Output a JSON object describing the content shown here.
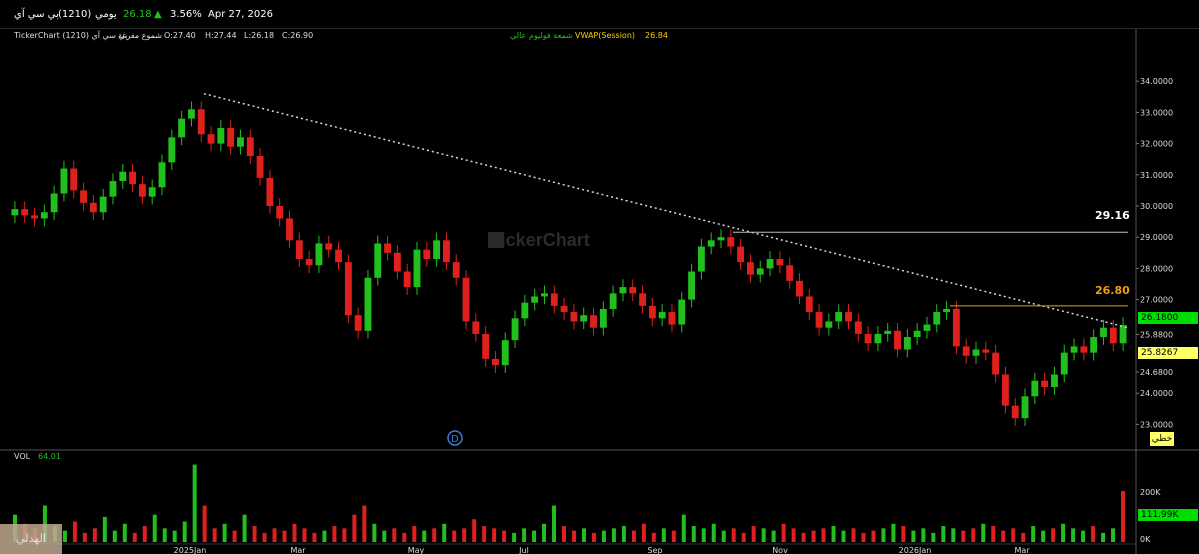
{
  "header": {
    "symbol": "بي سي آي",
    "code": "(1210)",
    "period": "يومي",
    "last_price": "26.18",
    "change_pct": "3.56%",
    "date": "Apr 27, 2026"
  },
  "info_bar": {
    "source": "TickerChart (1210) بي سي آي",
    "chart_type": "شموع مفرغة",
    "open": "O:27.40",
    "high": "H:27.44",
    "low": "L:26.18",
    "close": "C:26.90",
    "indicator_label": "شمعة فوليوم عالي",
    "vwap_label": "VWAP(Session)",
    "vwap_value": "26.84"
  },
  "watermark": "TickerChart",
  "colors": {
    "up": "#22c01e",
    "down": "#e0201c",
    "orange": "#f39c12",
    "price_tag": "#00dd00",
    "yellow_tag": "#ffff66",
    "line_label": "#ffffff",
    "dotted_trend": "#d8d8d8"
  },
  "price_axis": [
    "34.0000",
    "33.0000",
    "32.0000",
    "31.0000",
    "30.0000",
    "29.0000",
    "28.0000",
    "27.0000",
    "25.8800",
    "24.6800",
    "24.0000",
    "23.0000"
  ],
  "price_tags": {
    "current": "26.1800",
    "secondary": "25.8267",
    "mode": "خطي"
  },
  "level_labels": {
    "resistance_white": "29.16",
    "resistance_orange": "26.80"
  },
  "date_axis": [
    "2025Jan",
    "Mar",
    "May",
    "Jul",
    "Sep",
    "Nov",
    "2026Jan",
    "Mar"
  ],
  "volume_panel": {
    "label": "VOL",
    "value": "64.01",
    "axis_top": "200K",
    "axis_zero": "0K",
    "current_tag": "111.99K"
  },
  "dividend_marker": "D",
  "watermark_name": "الهذلي",
  "chart_data": {
    "type": "candlestick",
    "series": [
      {
        "name": "price",
        "values": [
          29.9,
          29.7,
          29.6,
          29.8,
          30.4,
          31.2,
          30.5,
          30.1,
          29.8,
          30.3,
          30.8,
          31.1,
          30.7,
          30.3,
          30.6,
          31.4,
          32.2,
          32.8,
          33.1,
          32.3,
          32.0,
          32.5,
          31.9,
          32.2,
          31.6,
          30.9,
          30.0,
          29.6,
          28.9,
          28.3,
          28.1,
          28.8,
          28.6,
          28.2,
          26.5,
          26.0,
          27.7,
          28.8,
          28.5,
          27.9,
          27.4,
          28.6,
          28.3,
          28.9,
          28.2,
          27.7,
          26.3,
          25.9,
          25.1,
          24.9,
          25.7,
          26.4,
          26.9,
          27.1,
          27.2,
          26.8,
          26.6,
          26.3,
          26.5,
          26.1,
          26.7,
          27.2,
          27.4,
          27.2,
          26.8,
          26.4,
          26.6,
          26.2,
          27.0,
          27.9,
          28.7,
          28.9,
          29.0,
          28.7,
          28.2,
          27.8,
          28.0,
          28.3,
          28.1,
          27.6,
          27.1,
          26.6,
          26.1,
          26.3,
          26.6,
          26.3,
          25.9,
          25.6,
          25.9,
          26.0,
          25.4,
          25.8,
          26.0,
          26.2,
          26.6,
          26.7,
          25.5,
          25.2,
          25.4,
          25.3,
          24.6,
          23.6,
          23.2,
          23.9,
          24.4,
          24.2,
          24.6,
          25.3,
          25.5,
          25.3,
          25.8,
          26.1,
          25.6,
          26.18
        ]
      },
      {
        "name": "VWAP(Session)",
        "values": [
          26.84
        ]
      }
    ],
    "volume": [
      60,
      40,
      30,
      80,
      35,
      25,
      45,
      20,
      30,
      55,
      25,
      40,
      20,
      35,
      60,
      30,
      25,
      45,
      170,
      80,
      30,
      40,
      25,
      60,
      35,
      20,
      30,
      25,
      40,
      30,
      20,
      25,
      35,
      30,
      60,
      80,
      40,
      25,
      30,
      20,
      35,
      25,
      30,
      40,
      25,
      30,
      50,
      35,
      30,
      25,
      20,
      30,
      25,
      40,
      80,
      35,
      25,
      30,
      20,
      25,
      30,
      35,
      25,
      40,
      20,
      30,
      25,
      60,
      35,
      30,
      40,
      25,
      30,
      20,
      35,
      30,
      25,
      40,
      30,
      20,
      25,
      30,
      35,
      25,
      30,
      20,
      25,
      30,
      40,
      35,
      25,
      30,
      20,
      35,
      30,
      25,
      30,
      40,
      35,
      25,
      30,
      20,
      35,
      25,
      30,
      40,
      30,
      25,
      35,
      20,
      30,
      112
    ],
    "ylim": [
      22.5,
      35.0
    ],
    "trendline_dotted": {
      "from": 33.6,
      "to": 26.1
    },
    "resistance_levels": [
      29.16,
      26.8
    ],
    "x_tick_labels": [
      "2025Jan",
      "Mar",
      "May",
      "Jul",
      "Sep",
      "Nov",
      "2026Jan",
      "Mar"
    ],
    "grid": false
  }
}
